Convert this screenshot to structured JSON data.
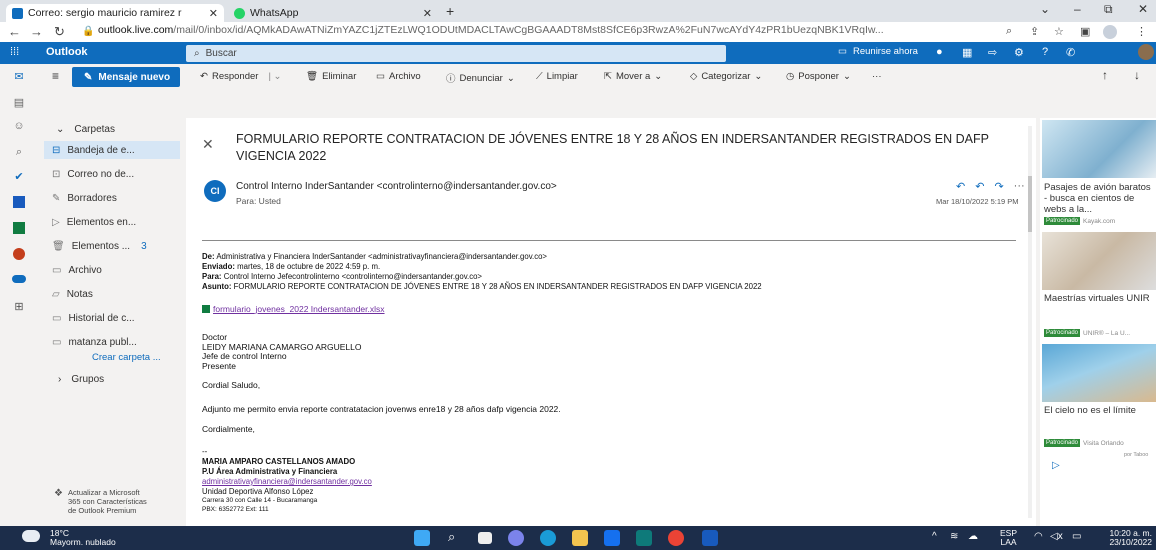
{
  "browser": {
    "tabs": [
      {
        "title": "Correo: sergio mauricio ramirez r",
        "close": "✕"
      },
      {
        "title": "WhatsApp",
        "close": "✕"
      }
    ],
    "new_tab": "+",
    "url_host": "outlook.live.com",
    "url_rest": "/mail/0/inbox/id/AQMkADAwATNiZmYAZC1jZTEzLWQ1ODUtMDACLTAwCgBGAAADT8Mst8SfCE6p3RwzA%2FuN7wcAYdY4zPR1bUezqNBK1VRqIw..."
  },
  "owa": {
    "app_name": "Outlook",
    "search_placeholder": "Buscar",
    "meet_now": "Reunirse ahora",
    "new_mail": "Mensaje nuevo"
  },
  "commands": [
    {
      "label": "Responder",
      "icon": "reply-icon"
    },
    {
      "label": "Eliminar",
      "icon": "trash-icon"
    },
    {
      "label": "Archivo",
      "icon": "archive-icon"
    },
    {
      "label": "Denunciar",
      "icon": "report-icon"
    },
    {
      "label": "Limpiar",
      "icon": "broom-icon"
    },
    {
      "label": "Mover a",
      "icon": "move-icon"
    },
    {
      "label": "Categorizar",
      "icon": "tag-icon"
    },
    {
      "label": "Posponer",
      "icon": "clock-icon"
    },
    {
      "label": "···",
      "icon": "more-icon"
    }
  ],
  "folders": {
    "header": "Carpetas",
    "items": [
      {
        "label": "Bandeja de e...",
        "count": ""
      },
      {
        "label": "Correo no de...",
        "count": ""
      },
      {
        "label": "Borradores",
        "count": ""
      },
      {
        "label": "Elementos en...",
        "count": ""
      },
      {
        "label": "Elementos ...",
        "count": "3"
      },
      {
        "label": "Archivo",
        "count": ""
      },
      {
        "label": "Notas",
        "count": ""
      },
      {
        "label": "Historial de c...",
        "count": ""
      },
      {
        "label": "matanza publ...",
        "count": ""
      }
    ],
    "create_folder": "Crear carpeta ...",
    "groups": "Grupos",
    "upgrade": [
      "Actualizar a Microsoft",
      "365 con Características",
      "de Outlook Premium"
    ]
  },
  "message": {
    "subject": "FORMULARIO REPORTE CONTRATACION DE JÓVENES ENTRE 18 Y 28 AÑOS EN INDERSANTANDER REGISTRADOS EN DAFP VIGENCIA 2022",
    "sender_initials": "CI",
    "sender": "Control Interno InderSantander <controlinterno@indersantander.gov.co>",
    "to": "Para:  Usted",
    "date": "Mar 18/10/2022 5:19 PM",
    "fwd_from_label": "De:",
    "fwd_from": "Administrativa y Financiera InderSantander <administrativayfinanciera@indersantander.gov.co>",
    "fwd_sent_label": "Enviado:",
    "fwd_sent": "martes, 18 de octubre de 2022 4:59 p. m.",
    "fwd_to_label": "Para:",
    "fwd_to": "Control Interno Jefecontrolinterno <controlinterno@indersantander.gov.co>",
    "fwd_subject_label": "Asunto:",
    "fwd_subject": "FORMULARIO REPORTE CONTRATACION DE JÓVENES ENTRE 18 Y 28 AÑOS EN INDERSANTANDER REGISTRADOS EN DAFP VIGENCIA 2022",
    "attachment": "formulario_jovenes_2022 Indersantander.xlsx",
    "addr": [
      "Doctor",
      "LEIDY MARIANA CAMARGO ARGUELLO",
      "Jefe de control Interno",
      "Presente"
    ],
    "greeting": "Cordial Saludo,",
    "body": "Adjunto me permito envia reporte contratatacion  jovenws enre18 y 28 años dafp vigencia 2022.",
    "closing": "Cordialmente,",
    "dashes": "--",
    "sig_name": "MARIA AMPARO CASTELLANOS AMADO",
    "sig_title": "P.U Área Administrativa y Financiera",
    "sig_email": "administrativayfinanciera@indersantander.gov.co",
    "sig_place": "Unidad Deportiva Alfonso López",
    "sig_addr": "Carrera 30 con Calle 14 - Bucaramanga",
    "sig_pbx": "PBX: 6352772  Ext: 111"
  },
  "ads": [
    {
      "text": "Pasajes de avión baratos - busca en cientos de webs a la...",
      "tag": "Patrocinado",
      "src": "Kayak.com"
    },
    {
      "text": "Maestrías virtuales UNIR",
      "tag": "Patrocinado",
      "src": "UNIR® – La U..."
    },
    {
      "text": "El cielo no es el límite",
      "tag": "Patrocinado",
      "src": "Visita Orlando"
    }
  ],
  "ads_footer": "por Taboo",
  "taskbar": {
    "weather_temp": "18°C",
    "weather_desc": "Mayorm. nublado",
    "lang1": "ESP",
    "lang2": "LAA",
    "time": "10:20 a. m.",
    "date": "23/10/2022"
  }
}
